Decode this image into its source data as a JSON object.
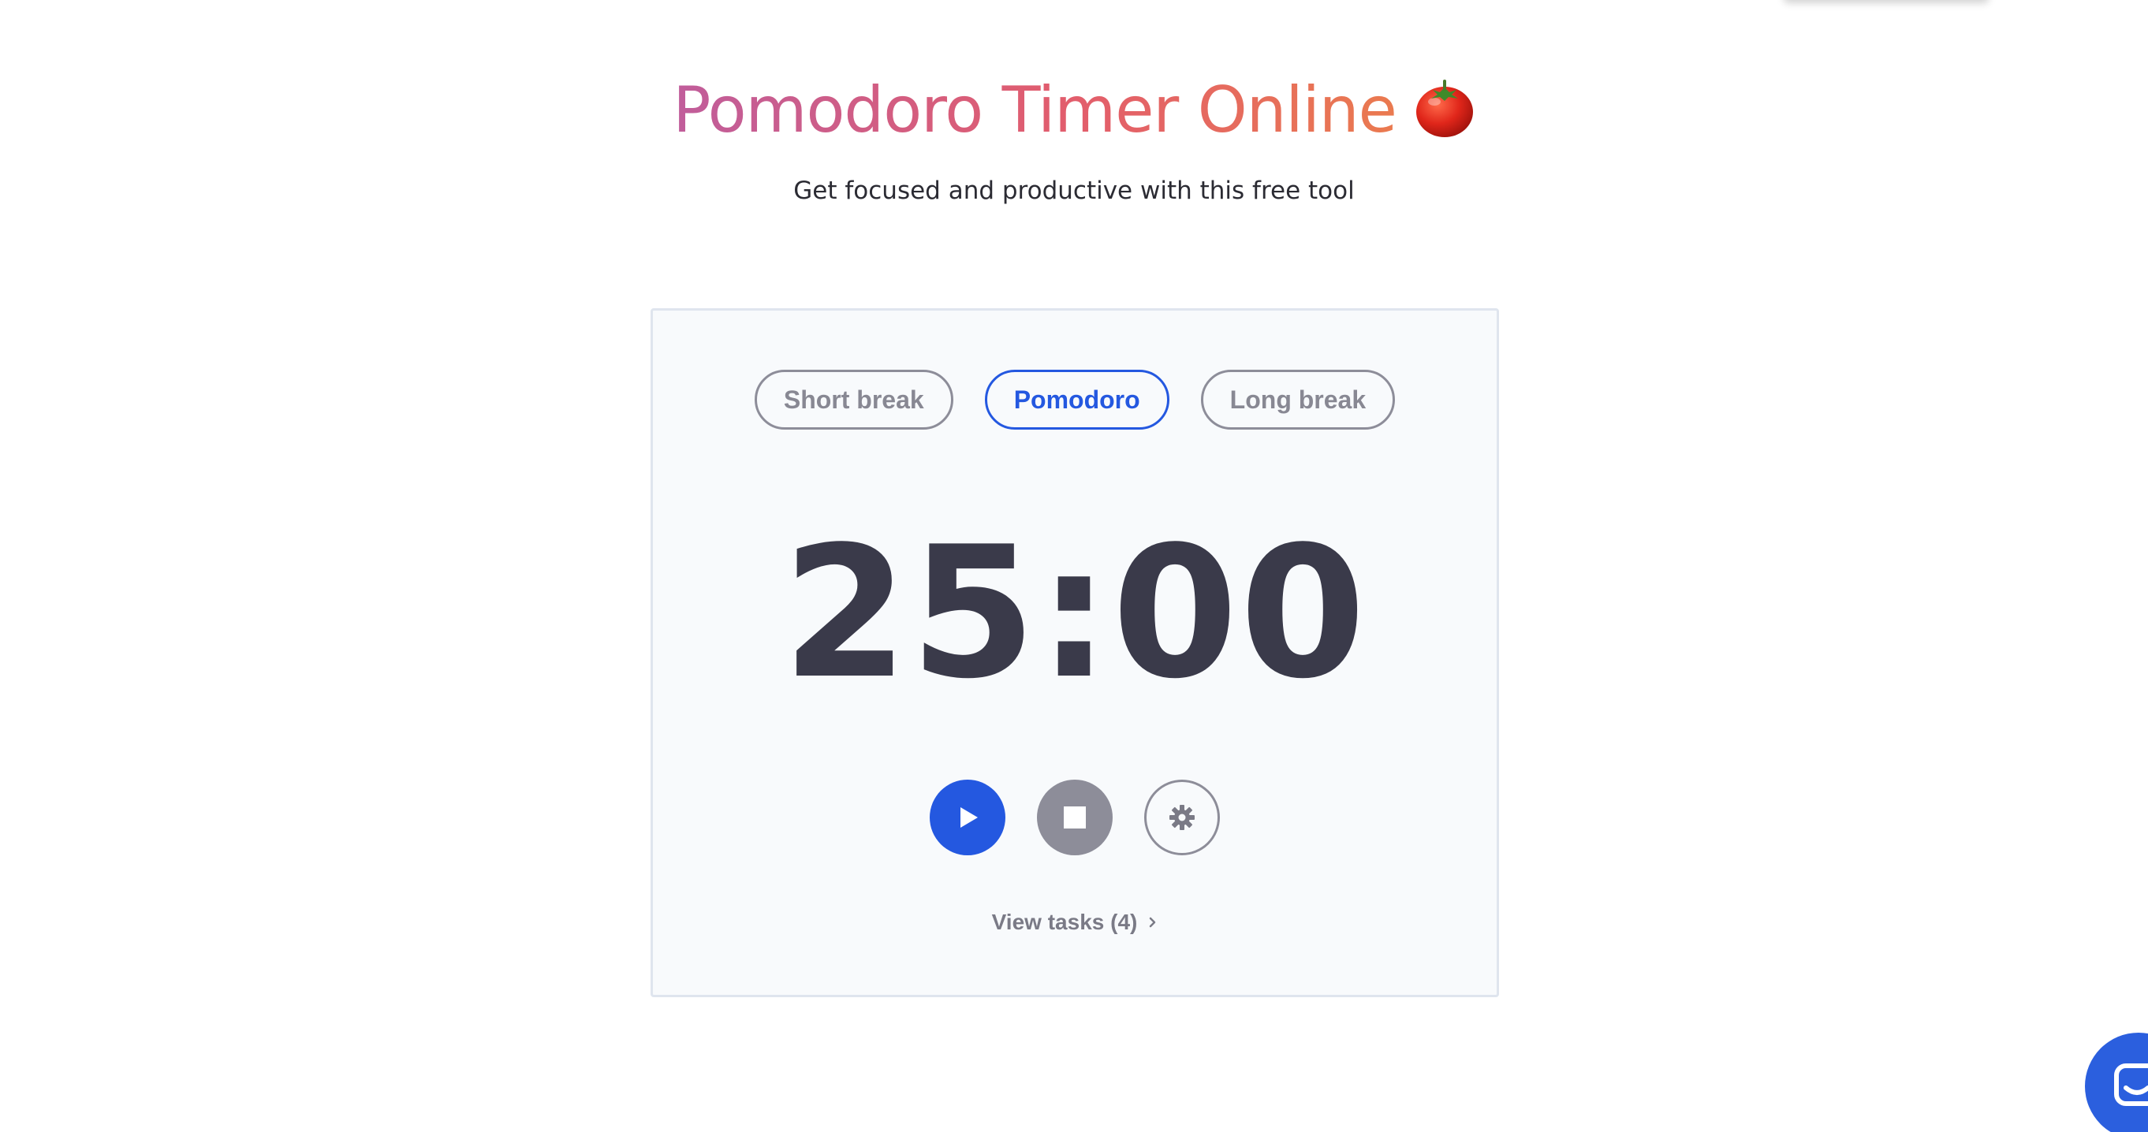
{
  "colors": {
    "accent": "#2458e0",
    "title_gradient_start": "#c05d9b",
    "title_gradient_mid": "#e25d6c",
    "title_gradient_end": "#ea7a4f"
  },
  "header": {
    "title": "Pomodoro Timer Online",
    "title_icon": "tomato-emoji",
    "subtitle": "Get focused and productive with this free tool"
  },
  "timer": {
    "modes": [
      {
        "label": "Short break",
        "active": false
      },
      {
        "label": "Pomodoro",
        "active": true
      },
      {
        "label": "Long break",
        "active": false
      }
    ],
    "display": "25:00",
    "controls": {
      "play_icon": "play-icon",
      "stop_icon": "stop-icon",
      "settings_icon": "gear-icon"
    },
    "view_tasks_label": "View tasks (4)",
    "view_tasks_icon": "chevron-right-icon"
  },
  "chat": {
    "icon": "chat-icon"
  }
}
